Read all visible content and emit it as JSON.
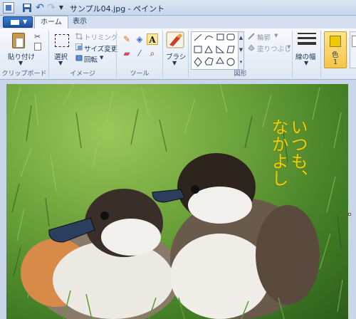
{
  "window": {
    "title": "サンプル04.jpg - ペイント"
  },
  "tabs": [
    {
      "label": "ホーム"
    },
    {
      "label": "表示"
    }
  ],
  "ribbon": {
    "clipboard": {
      "paste_label": "貼り付け",
      "group_label": "クリップボード"
    },
    "image": {
      "select_label": "選択",
      "crop_label": "トリミング",
      "resize_label": "サイズ変更",
      "rotate_label": "回転",
      "group_label": "イメージ"
    },
    "tools": {
      "group_label": "ツール"
    },
    "brushes": {
      "label": "ブラシ"
    },
    "shapes": {
      "outline_label": "輪郭",
      "fill_label": "塗りつぶし",
      "group_label": "図形"
    },
    "size": {
      "label": "線の幅"
    },
    "colors": {
      "color1_label": "色",
      "color1_sub": "1",
      "color1_value": "#f0c800"
    }
  },
  "canvas": {
    "text_line1": "いつも、",
    "text_line2": "なかよし"
  }
}
